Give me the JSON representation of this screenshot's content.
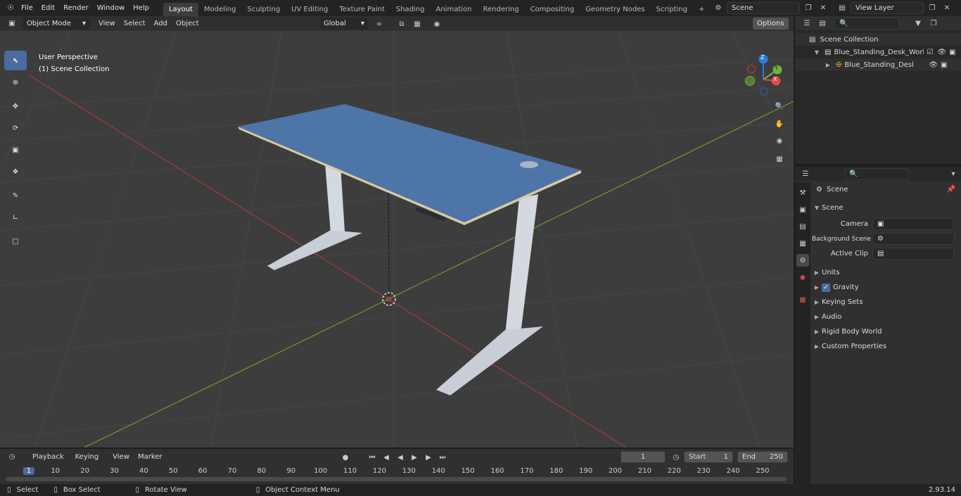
{
  "app": {
    "version": "2.93.14"
  },
  "menu": [
    "File",
    "Edit",
    "Render",
    "Window",
    "Help"
  ],
  "workspaces": [
    "Layout",
    "Modeling",
    "Sculpting",
    "UV Editing",
    "Texture Paint",
    "Shading",
    "Animation",
    "Rendering",
    "Compositing",
    "Geometry Nodes",
    "Scripting"
  ],
  "active_workspace": "Layout",
  "scene_field": "Scene",
  "viewlayer_field": "View Layer",
  "viewport_header": {
    "mode": "Object Mode",
    "menus": [
      "View",
      "Select",
      "Add",
      "Object"
    ],
    "orientation": "Global",
    "options": "Options"
  },
  "viewport": {
    "perspective_label": "User Perspective",
    "collection_label": "(1) Scene Collection",
    "gizmo_labels": {
      "z": "Z",
      "y": "Y",
      "x": "X"
    }
  },
  "outliner": {
    "root": "Scene Collection",
    "items": [
      {
        "label": "Blue_Standing_Desk_Worksta"
      },
      {
        "label": "Blue_Standing_Desk_Wo"
      }
    ]
  },
  "properties": {
    "context": "Scene",
    "panel": "Scene",
    "fields": [
      {
        "label": "Camera"
      },
      {
        "label": "Background Scene"
      },
      {
        "label": "Active Clip"
      }
    ],
    "sections": [
      "Units",
      "Gravity",
      "Keying Sets",
      "Audio",
      "Rigid Body World",
      "Custom Properties"
    ]
  },
  "timeline": {
    "menus": [
      "Playback",
      "Keying",
      "View",
      "Marker"
    ],
    "current_frame": "1",
    "start_label": "Start",
    "start": "1",
    "end_label": "End",
    "end": "250",
    "ticks": [
      "1",
      "10",
      "20",
      "30",
      "40",
      "50",
      "60",
      "70",
      "80",
      "90",
      "100",
      "110",
      "120",
      "130",
      "140",
      "150",
      "160",
      "170",
      "180",
      "190",
      "200",
      "210",
      "220",
      "230",
      "240",
      "250"
    ]
  },
  "status": {
    "items": [
      "Select",
      "Box Select",
      "Rotate View",
      "Object Context Menu"
    ]
  },
  "colors": {
    "accent": "#4b6aa0",
    "desk_top": "#4e75a8",
    "desk_legs": "#d4d9e0",
    "x_axis": "#a33a3a",
    "y_axis": "#6f9b2e"
  }
}
